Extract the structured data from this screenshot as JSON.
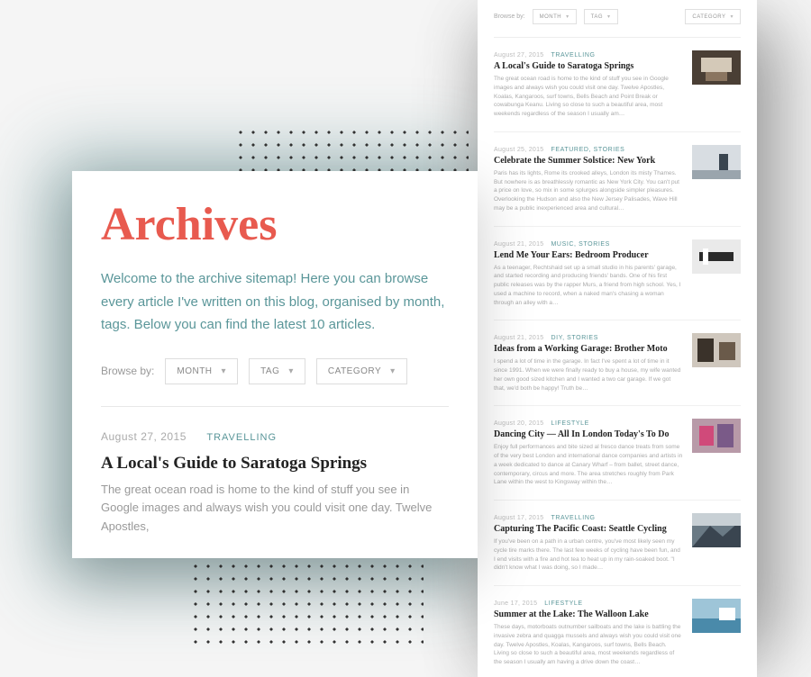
{
  "header": {
    "title": "Archives",
    "intro": "Welcome to the archive sitemap! Here you can browse every article I've written on this blog, organised by month, tags. Below you can find the latest 10 articles."
  },
  "browse": {
    "label": "Browse by:",
    "selects": [
      "MONTH",
      "TAG",
      "CATEGORY"
    ]
  },
  "featured_post": {
    "date": "August 27, 2015",
    "categories": "TRAVELLING",
    "title": "A Local's Guide to Saratoga Springs",
    "excerpt": "The great ocean road is home to the kind of stuff you see in Google images and always wish you could visit one day. Twelve Apostles,"
  },
  "posts": [
    {
      "date": "August 27, 2015",
      "categories": "TRAVELLING",
      "title": "A Local's Guide to Saratoga Springs",
      "excerpt": "The great ocean road is home to the kind of stuff you see in Google images and always wish you could visit one day. Twelve Apostles, Koalas, Kangaroos, surf towns, Bells Beach and Point Break or cowabunga Keanu. Living so close to such a beautiful area, most weekends regardless of the season I usually am…"
    },
    {
      "date": "August 25, 2015",
      "categories": "FEATURED, STORIES",
      "title": "Celebrate the Summer Solstice: New York",
      "excerpt": "Paris has its lights, Rome its crooked alleys, London its misty Thames. But nowhere is as breathlessly romantic as New York City. You can't put a price on love, so mix in some splurges alongside simpler pleasures. Overlooking the Hudson and also the New Jersey Palisades, Wave Hill may be a public inexperienced area and cultural…"
    },
    {
      "date": "August 21, 2015",
      "categories": "MUSIC, STORIES",
      "title": "Lend Me Your Ears: Bedroom Producer",
      "excerpt": "As a teenager, Rechtshaid set up a small studio in his parents' garage, and started recording and producing friends' bands. One of his first public releases was by the rapper Murs, a friend from high school. Yes, I used a machine to record, when a naked man's chasing a woman through an alley with a…"
    },
    {
      "date": "August 21, 2015",
      "categories": "DIY, STORIES",
      "title": "Ideas from a Working Garage: Brother Moto",
      "excerpt": "I spend a lot of time in the garage. In fact I've spent a lot of time in it since 1991. When we were finally ready to buy a house, my wife wanted her own good sized kitchen and I wanted a two car garage. If we got that, we'd both be happy! Truth be…"
    },
    {
      "date": "August 20, 2015",
      "categories": "LIFESTYLE",
      "title": "Dancing City — All In London Today's To Do",
      "excerpt": "Enjoy full performances and bite sized al fresco dance treats from some of the very best London and international dance companies and artists in a week dedicated to dance at Canary Wharf – from ballet, street dance, contemporary, circus and more. The area stretches roughly from Park Lane within the west to Kingsway within the…"
    },
    {
      "date": "August 17, 2015",
      "categories": "TRAVELLING",
      "title": "Capturing The Pacific Coast: Seattle Cycling",
      "excerpt": "If you've been on a path in a urban centre, you've most likely seen my cycle tire marks there. The last few weeks of cycling have been fun, and I end visits with a fire and hot tea to heat up in my rain-soaked boot. \"I didn't know what I was doing, so I made…"
    },
    {
      "date": "June 17, 2015",
      "categories": "LIFESTYLE",
      "title": "Summer at the Lake: The Walloon Lake",
      "excerpt": "These days, motorboats outnumber sailboats and the lake is battling the invasive zebra and quagga mussels and always wish you could visit one day. Twelve Apostles, Koalas, Kangaroos, surf towns, Bells Beach. Living so close to such a beautiful area, most weekends regardless of the season I usually am having a drive down the coast…"
    }
  ]
}
